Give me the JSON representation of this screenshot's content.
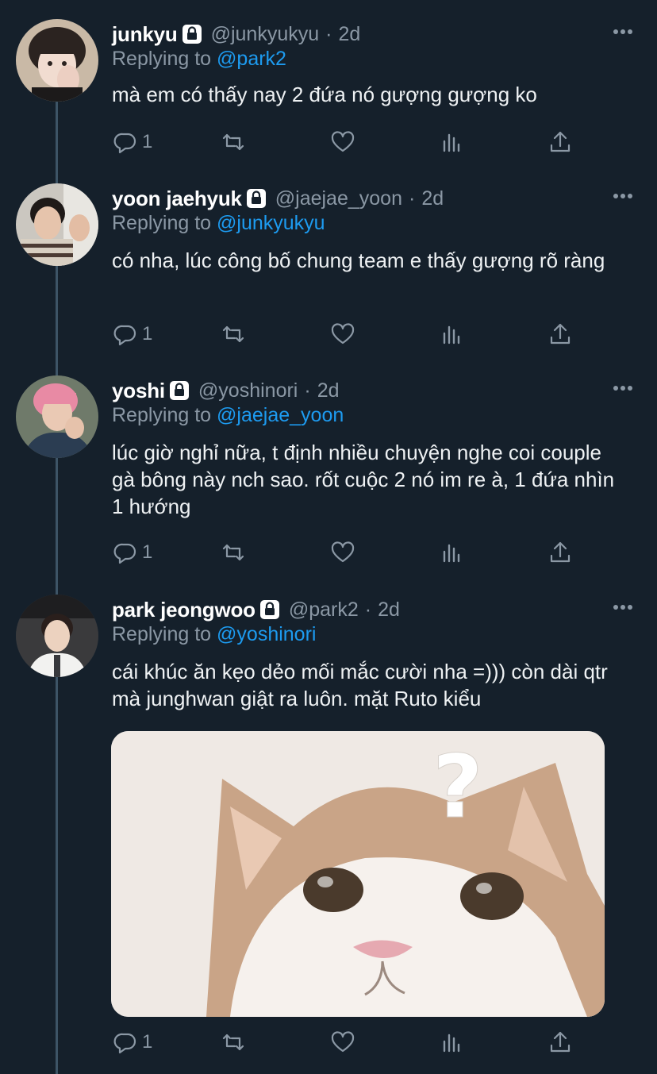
{
  "tweets": [
    {
      "name": "junkyu",
      "handle": "@junkyukyu",
      "dot": "·",
      "time": "2d",
      "reply_prefix": "Replying to",
      "reply_to": "@park2",
      "text": "mà em có thấy nay 2 đứa nó gượng gượng ko",
      "reply_count": "1",
      "protected": true
    },
    {
      "name": "yoon jaehyuk",
      "handle": "@jaejae_yoon",
      "dot": "·",
      "time": "2d",
      "reply_prefix": "Replying to",
      "reply_to": "@junkyukyu",
      "text": "có nha, lúc công bố chung team e thấy gượng rõ ràng",
      "reply_count": "1",
      "protected": true
    },
    {
      "name": "yoshi",
      "handle": "@yoshinori",
      "dot": "·",
      "time": "2d",
      "reply_prefix": "Replying to",
      "reply_to": "@jaejae_yoon",
      "text": "lúc giờ nghỉ nữa, t định nhiều chuyện nghe coi couple gà bông này nch sao. rốt cuộc 2 nó im re à, 1 đứa nhìn 1 hướng",
      "reply_count": "1",
      "protected": true
    },
    {
      "name": "park jeongwoo",
      "handle": "@park2",
      "dot": "·",
      "time": "2d",
      "reply_prefix": "Replying to",
      "reply_to": "@yoshinori",
      "text": "cái khúc ăn kẹo dẻo mối mắc cười nha =))) còn dài qtr mà junghwan giật ra luôn. mặt Ruto kiểu",
      "reply_count": "1",
      "protected": true,
      "media": "cat-photo-with-question-mark"
    }
  ],
  "icons": {
    "lock": "lock-icon",
    "more": "more-horizontal-icon",
    "reply": "reply-icon",
    "retweet": "retweet-icon",
    "like": "heart-icon",
    "stats": "analytics-icon",
    "share": "share-icon"
  },
  "colors": {
    "background": "#15202b",
    "text": "#eef1f3",
    "muted": "#8b98a5",
    "link": "#1d9bf0",
    "thread_line": "#3d5466"
  }
}
